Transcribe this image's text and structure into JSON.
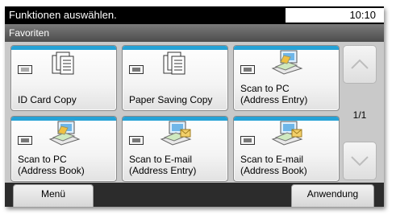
{
  "header": {
    "title": "Funktionen auswählen.",
    "time": "10:10"
  },
  "subheader": {
    "title": "Favoriten"
  },
  "tiles": [
    {
      "line1": "ID Card Copy",
      "line2": "",
      "icon": "document-icon"
    },
    {
      "line1": "Paper Saving Copy",
      "line2": "",
      "icon": "document-icon"
    },
    {
      "line1": "Scan to PC",
      "line2": "(Address Entry)",
      "icon": "scan-to-pc-icon"
    },
    {
      "line1": "Scan to PC",
      "line2": "(Address Book)",
      "icon": "scan-to-pc-icon"
    },
    {
      "line1": "Scan to E-mail",
      "line2": "(Address Entry)",
      "icon": "scan-to-email-icon"
    },
    {
      "line1": "Scan to E-mail",
      "line2": "(Address Book)",
      "icon": "scan-to-email-icon"
    }
  ],
  "pagination": {
    "indicator": "1/1"
  },
  "footer": {
    "menu_label": "Menü",
    "apply_label": "Anwendung"
  },
  "colors": {
    "accent_stripe": "#26a2d6",
    "title_bar": "#000000",
    "background": "#c9c9c9"
  }
}
